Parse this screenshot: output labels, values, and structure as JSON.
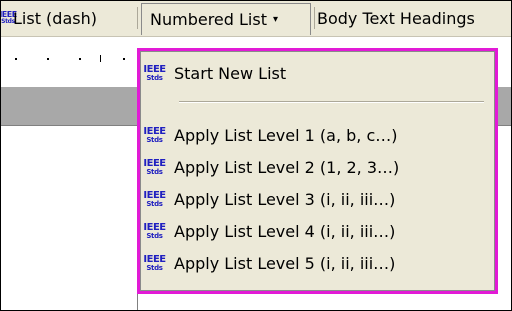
{
  "toolbar": {
    "list_dash": "List (dash)",
    "numbered_list": "Numbered List",
    "body_text_headings": "Body Text Headings",
    "dropdown_caret": "▾"
  },
  "icon": {
    "line1": "IEEE",
    "line2": "Stds"
  },
  "menu": {
    "items": [
      {
        "label": "Start New List"
      },
      {
        "label": "Apply List Level 1 (a, b, c…)"
      },
      {
        "label": "Apply List Level 2 (1, 2, 3…)"
      },
      {
        "label": "Apply List Level 3 (i, ii, iii…)"
      },
      {
        "label": "Apply List Level 4 (i, ii, iii…)"
      },
      {
        "label": "Apply List Level 5 (i, ii, iii…)"
      }
    ]
  },
  "colors": {
    "highlight_border": "#e21ad6",
    "menu_background": "#ece9d8",
    "icon_blue": "#2020c0"
  }
}
